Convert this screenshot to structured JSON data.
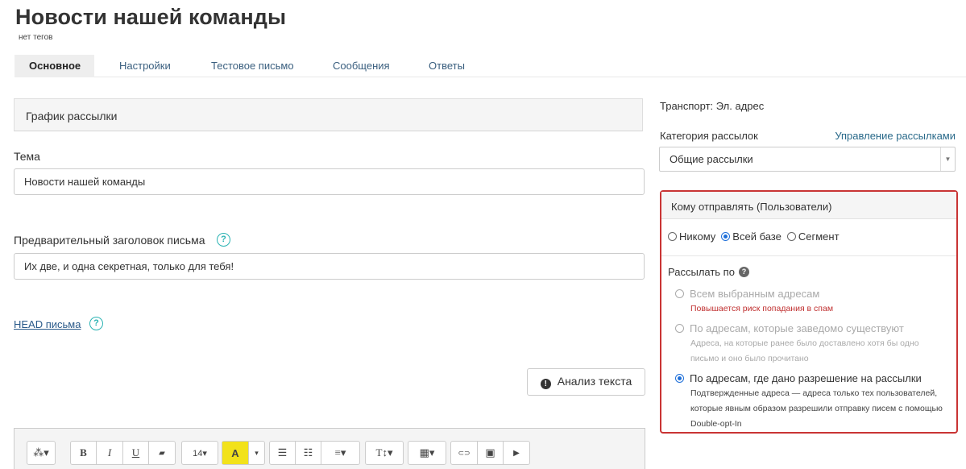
{
  "header": {
    "title": "Новости нашей команды",
    "tags": "нет тегов"
  },
  "tabs": [
    {
      "label": "Основное",
      "active": true
    },
    {
      "label": "Настройки"
    },
    {
      "label": "Тестовое письмо"
    },
    {
      "label": "Сообщения"
    },
    {
      "label": "Ответы"
    }
  ],
  "main": {
    "schedule_label": "График рассылки",
    "subject_label": "Тема",
    "subject_value": "Новости нашей команды",
    "preheader_label": "Предварительный заголовок письма",
    "preheader_value": "Их две, и одна секретная, только для тебя!",
    "head_link": "HEAD письма",
    "analyze_button": "Анализ текста"
  },
  "editor_toolbar": {
    "magic": "⁂▾",
    "bold": "B",
    "italic": "I",
    "underline": "U",
    "eraser": "▰",
    "font_size": "14▾",
    "highlight": "A",
    "caret": "▾",
    "bullet_list": "☰",
    "ordered_list": "☷",
    "align": "≡▾",
    "text_style": "T↕▾",
    "table": "▦▾",
    "link": "⊂⊃",
    "image": "▣",
    "video": "▶"
  },
  "side": {
    "transport": "Транспорт: Эл. адрес",
    "category_label": "Категория рассылок",
    "manage_link": "Управление рассылками",
    "category_value": "Общие рассылки",
    "recipients": {
      "header": "Кому отправлять (Пользователи)",
      "options": [
        "Никому",
        "Всей базе",
        "Сегмент"
      ],
      "selected": "Всей базе",
      "send_by_label": "Рассылать по",
      "send_options": [
        {
          "label": "Всем выбранным адресам",
          "desc": "Повышается риск попадания в спам"
        },
        {
          "label": "По адресам, которые заведомо существуют",
          "desc": "Адреса, на которые ранее было доставлено хотя бы одно письмо и оно было прочитано"
        },
        {
          "label": "По адресам, где дано разрешение на рассылки",
          "desc": "Подтвержденные адреса — адреса только тех пользователей, которые явным образом разрешили отправку писем с помощью Double-opt-In"
        }
      ],
      "send_selected": "По адресам, где дано разрешение на рассылки"
    }
  },
  "colors": {
    "accent_border": "#c93434",
    "help_icon": "#2ab3b3",
    "radio_selected": "#1e6fd9",
    "highlight_yellow": "#f2e21a"
  }
}
